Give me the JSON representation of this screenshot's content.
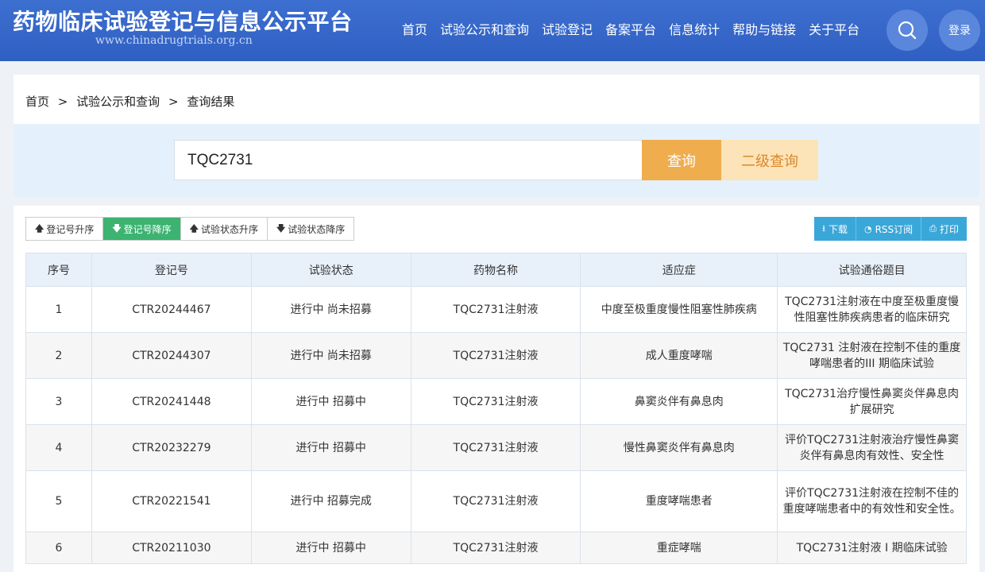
{
  "header": {
    "title": "药物临床试验登记与信息公示平台",
    "url": "www.chinadrugtrials.org.cn",
    "nav": [
      "首页",
      "试验公示和查询",
      "试验登记",
      "备案平台",
      "信息统计",
      "帮助与链接",
      "关于平台"
    ],
    "login": "登录"
  },
  "breadcrumb": [
    "首页",
    ">",
    "试验公示和查询",
    ">",
    "查询结果"
  ],
  "search": {
    "value": "TQC2731",
    "query_label": "查询",
    "advanced_label": "二级查询"
  },
  "sort": [
    "登记号升序",
    "登记号降序",
    "试验状态升序",
    "试验状态降序"
  ],
  "actions": [
    "下载",
    "RSS订阅",
    "打印"
  ],
  "colors": {
    "header": "#2f5fc2",
    "query": "#f0ad4e",
    "advanced": "#fde3b8",
    "active_sort": "#3cb371",
    "action": "#3aa7d9"
  },
  "table": {
    "headers": [
      "序号",
      "登记号",
      "试验状态",
      "药物名称",
      "适应症",
      "试验通俗题目"
    ],
    "rows": [
      [
        "1",
        "CTR20244467",
        "进行中 尚未招募",
        "TQC2731注射液",
        "中度至极重度慢性阻塞性肺疾病",
        "TQC2731注射液在中度至极重度慢性阻塞性肺疾病患者的临床研究"
      ],
      [
        "2",
        "CTR20244307",
        "进行中 尚未招募",
        "TQC2731注射液",
        "成人重度哮喘",
        "TQC2731 注射液在控制不佳的重度哮喘患者的III 期临床试验"
      ],
      [
        "3",
        "CTR20241448",
        "进行中 招募中",
        "TQC2731注射液",
        "鼻窦炎伴有鼻息肉",
        "TQC2731治疗慢性鼻窦炎伴鼻息肉扩展研究"
      ],
      [
        "4",
        "CTR20232279",
        "进行中 招募中",
        "TQC2731注射液",
        "慢性鼻窦炎伴有鼻息肉",
        "评价TQC2731注射液治疗慢性鼻窦炎伴有鼻息肉有效性、安全性"
      ],
      [
        "5",
        "CTR20221541",
        "进行中 招募完成",
        "TQC2731注射液",
        "重度哮喘患者",
        "评价TQC2731注射液在控制不佳的重度哮喘患者中的有效性和安全性。"
      ],
      [
        "6",
        "CTR20211030",
        "进行中 招募中",
        "TQC2731注射液",
        "重症哮喘",
        "TQC2731注射液 I 期临床试验"
      ]
    ]
  }
}
